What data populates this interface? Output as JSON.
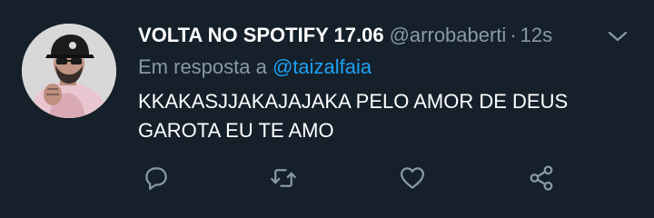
{
  "tweet": {
    "display_name": "VOLTA NO SPOTIFY 17.06",
    "handle": "@arrobaberti",
    "separator": "·",
    "time": "12s",
    "reply_prefix": "Em resposta a",
    "reply_to": "@taizalfaia",
    "text_lines": [
      "KKAKASJJAKAJAJAKA PELO AMOR DE DEUS",
      "GAROTA EU TE AMO"
    ]
  },
  "icons": {
    "menu": "chevron-down-icon",
    "reply": "reply-icon",
    "retweet": "retweet-icon",
    "like": "heart-icon",
    "share": "share-icon",
    "avatar": "profile-photo"
  },
  "colors": {
    "background": "#15202b",
    "primary_text": "#ffffff",
    "secondary_text": "#8899a6",
    "link": "#1da1f2"
  }
}
